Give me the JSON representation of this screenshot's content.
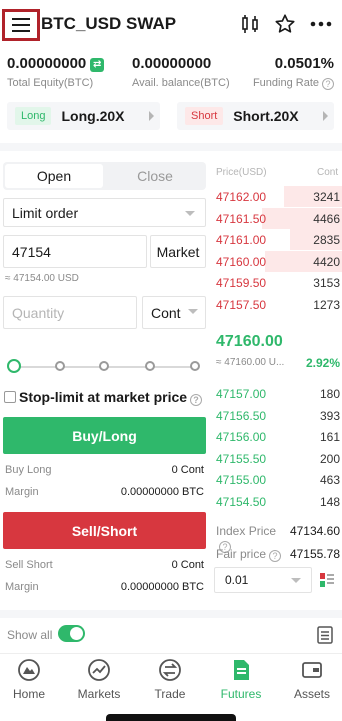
{
  "header": {
    "title": "BTC_USD SWAP",
    "menu_icon": "hamburger-menu-icon"
  },
  "balances": {
    "total_equity": {
      "value": "0.00000000",
      "label": "Total Equity(BTC)"
    },
    "avail_balance": {
      "value": "0.00000000",
      "label": "Avail. balance(BTC)"
    },
    "funding_rate": {
      "value": "0.0501%",
      "label": "Funding Rate"
    }
  },
  "leverage": {
    "long": {
      "tag": "Long",
      "value": "Long.20X"
    },
    "short": {
      "tag": "Short",
      "value": "Short.20X"
    }
  },
  "order_form": {
    "tabs": {
      "open": "Open",
      "close": "Close"
    },
    "order_type": "Limit order",
    "price_value": "47154",
    "market_label": "Market",
    "price_note": "≈ 47154.00 USD",
    "quantity_placeholder": "Quantity",
    "unit": "Cont",
    "slider_position": 0,
    "stop_limit_label": "Stop-limit at market price",
    "buy_label": "Buy/Long",
    "sell_label": "Sell/Short",
    "buy_info": {
      "buy_long_label": "Buy Long",
      "buy_long_value": "0 Cont",
      "margin_label": "Margin",
      "margin_value": "0.00000000 BTC"
    },
    "sell_info": {
      "sell_short_label": "Sell Short",
      "sell_short_value": "0 Cont",
      "margin_label": "Margin",
      "margin_value": "0.00000000 BTC"
    }
  },
  "orderbook": {
    "price_header": "Price(USD)",
    "qty_header": "Cont",
    "asks": [
      {
        "price": "47162.00",
        "qty": "3241",
        "depth": 0.45
      },
      {
        "price": "47161.50",
        "qty": "4466",
        "depth": 0.62
      },
      {
        "price": "47161.00",
        "qty": "2835",
        "depth": 0.4
      },
      {
        "price": "47160.00",
        "qty": "4420",
        "depth": 0.6
      },
      {
        "price": "47159.50",
        "qty": "3153",
        "depth": 0.0
      },
      {
        "price": "47157.50",
        "qty": "1273",
        "depth": 0.0
      }
    ],
    "last_price": "47160.00",
    "last_price_usd": "≈ 47160.00 U...",
    "change": "2.92%",
    "bids": [
      {
        "price": "47157.00",
        "qty": "180"
      },
      {
        "price": "47156.50",
        "qty": "393"
      },
      {
        "price": "47156.00",
        "qty": "161"
      },
      {
        "price": "47155.50",
        "qty": "200"
      },
      {
        "price": "47155.00",
        "qty": "463"
      },
      {
        "price": "47154.50",
        "qty": "148"
      }
    ],
    "index_price_label": "Index Price",
    "index_price": "47134.60",
    "fair_price_label": "Fair price",
    "fair_price": "47155.78",
    "depth_select": "0.01"
  },
  "positions": {
    "show_all_label": "Show all",
    "show_all_on": true
  },
  "bottom_nav": [
    {
      "label": "Home",
      "icon": "home-icon"
    },
    {
      "label": "Markets",
      "icon": "markets-icon"
    },
    {
      "label": "Trade",
      "icon": "trade-icon"
    },
    {
      "label": "Futures",
      "icon": "futures-icon",
      "active": true
    },
    {
      "label": "Assets",
      "icon": "assets-icon"
    }
  ],
  "colors": {
    "green": "#2fb86b",
    "red": "#d7373f",
    "highlight": "#b0222a"
  }
}
